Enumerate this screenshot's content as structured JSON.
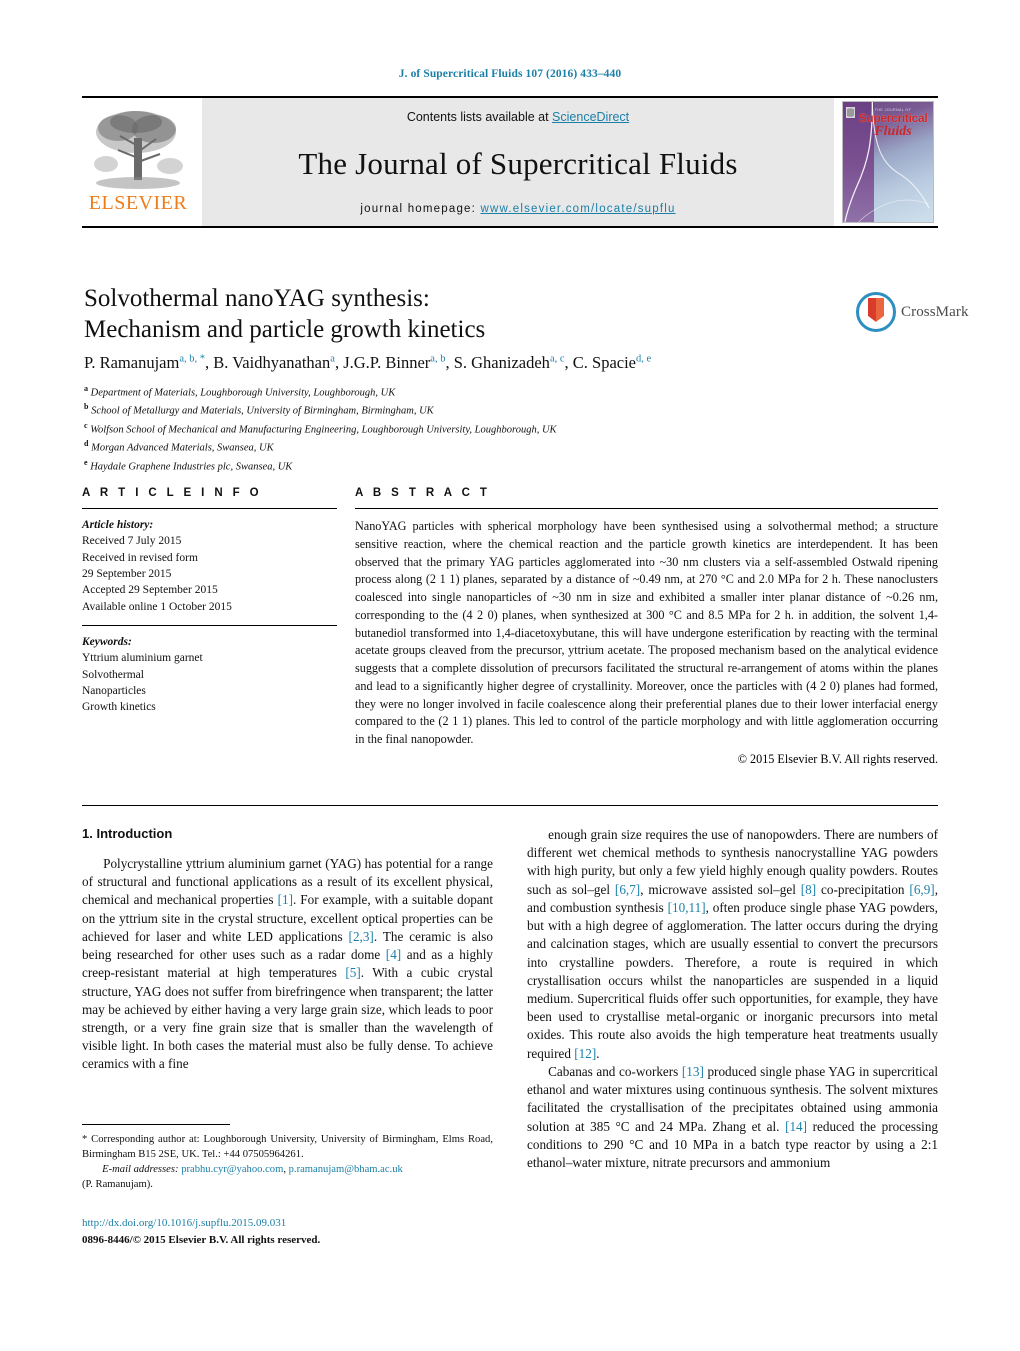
{
  "running_head": "J. of Supercritical Fluids 107 (2016) 433–440",
  "masthead": {
    "contents_prefix": "Contents lists available at ",
    "sciencedirect": "ScienceDirect",
    "journal_title": "The Journal of Supercritical Fluids",
    "homepage_label": "journal homepage:",
    "homepage_url": "www.elsevier.com/locate/supflu",
    "publisher": "ELSEVIER",
    "cover": {
      "kicker": "THE JOURNAL OF",
      "line1": "Supercritical",
      "line2": "Fluids"
    }
  },
  "article": {
    "title_line1": "Solvothermal nanoYAG synthesis:",
    "title_line2": "Mechanism and particle growth kinetics",
    "crossmark_label": "CrossMark",
    "authors": [
      {
        "name": "P. Ramanujam",
        "marks": "a, b, *"
      },
      {
        "name": "B. Vaidhyanathan",
        "marks": "a"
      },
      {
        "name": "J.G.P. Binner",
        "marks": "a, b"
      },
      {
        "name": "S. Ghanizadeh",
        "marks": "a, c"
      },
      {
        "name": "C. Spacie",
        "marks": "d, e"
      }
    ],
    "affiliations": [
      {
        "label": "a",
        "text": "Department of Materials, Loughborough University, Loughborough, UK"
      },
      {
        "label": "b",
        "text": "School of Metallurgy and Materials, University of Birmingham, Birmingham, UK"
      },
      {
        "label": "c",
        "text": "Wolfson School of Mechanical and Manufacturing Engineering, Loughborough University, Loughborough, UK"
      },
      {
        "label": "d",
        "text": "Morgan Advanced Materials, Swansea, UK"
      },
      {
        "label": "e",
        "text": "Haydale Graphene Industries plc, Swansea, UK"
      }
    ]
  },
  "article_info": {
    "heading": "A R T I C L E   I N F O",
    "history_label": "Article history:",
    "history": [
      "Received 7 July 2015",
      "Received in revised form",
      "29 September 2015",
      "Accepted 29 September 2015",
      "Available online 1 October 2015"
    ],
    "keywords_label": "Keywords:",
    "keywords": [
      "Yttrium aluminium garnet",
      "Solvothermal",
      "Nanoparticles",
      "Growth kinetics"
    ]
  },
  "abstract": {
    "heading": "A B S T R A C T",
    "text": "NanoYAG particles with spherical morphology have been synthesised using a solvothermal method; a structure sensitive reaction, where the chemical reaction and the particle growth kinetics are interdependent. It has been observed that the primary YAG particles agglomerated into ~30 nm clusters via a self-assembled Ostwald ripening process along (2 1 1) planes, separated by a distance of ~0.49 nm, at 270 °C and 2.0 MPa for 2 h. These nanoclusters coalesced into single nanoparticles of ~30 nm in size and exhibited a smaller inter planar distance of ~0.26 nm, corresponding to the (4 2 0) planes, when synthesized at 300 °C and 8.5 MPa for 2 h. in addition, the solvent 1,4-butanediol transformed into 1,4-diacetoxybutane, this will have undergone esterification by reacting with the terminal acetate groups cleaved from the precursor, yttrium acetate. The proposed mechanism based on the analytical evidence suggests that a complete dissolution of precursors facilitated the structural re-arrangement of atoms within the planes and lead to a significantly higher degree of crystallinity. Moreover, once the particles with (4 2 0) planes had formed, they were no longer involved in facile coalescence along their preferential planes due to their lower interfacial energy compared to the (2 1 1) planes. This led to control of the particle morphology and with little agglomeration occurring in the final nanopowder.",
    "copyright": "© 2015 Elsevier B.V. All rights reserved."
  },
  "body": {
    "section_number_title": "1.  Introduction",
    "left_paragraph_1": "Polycrystalline yttrium aluminium garnet (YAG) has potential for a range of structural and functional applications as a result of its excellent physical, chemical and mechanical properties [1]. For example, with a suitable dopant on the yttrium site in the crystal structure, excellent optical properties can be achieved for laser and white LED applications [2,3]. The ceramic is also being researched for other uses such as a radar dome [4] and as a highly creep-resistant material at high temperatures [5]. With a cubic crystal structure, YAG does not suffer from birefringence when transparent; the latter may be achieved by either having a very large grain size, which leads to poor strength, or a very fine grain size that is smaller than the wavelength of visible light. In both cases the material must also be fully dense. To achieve ceramics with a fine",
    "right_paragraph_1": "enough grain size requires the use of nanopowders. There are numbers of different wet chemical methods to synthesis nanocrystalline YAG powders with high purity, but only a few yield highly enough quality powders. Routes such as sol–gel [6,7], microwave assisted sol–gel [8] co-precipitation [6,9], and combustion synthesis [10,11], often produce single phase YAG powders, but with a high degree of agglomeration. The latter occurs during the drying and calcination stages, which are usually essential to convert the precursors into crystalline powders. Therefore, a route is required in which crystallisation occurs whilst the nanoparticles are suspended in a liquid medium. Supercritical fluids offer such opportunities, for example, they have been used to crystallise metal-organic or inorganic precursors into metal oxides. This route also avoids the high temperature heat treatments usually required [12].",
    "right_paragraph_2": "Cabanas and co-workers [13] produced single phase YAG in supercritical ethanol and water mixtures using continuous synthesis. The solvent mixtures facilitated the crystallisation of the precipitates obtained using ammonia solution at 385 °C and 24 MPa. Zhang et al. [14] reduced the processing conditions to 290 °C and 10 MPa in a batch type reactor by using a 2:1 ethanol–water mixture, nitrate precursors and ammonium"
  },
  "footnote": {
    "corresponding": "* Corresponding author at: Loughborough University, University of Birmingham, Elms Road, Birmingham B15 2SE, UK. Tel.: +44 07505964261.",
    "email_label": "E-mail addresses:",
    "email1": "prabhu.cyr@yahoo.com",
    "email_sep": ", ",
    "email2": "p.ramanujam@bham.ac.uk",
    "email_owner": "(P. Ramanujam)."
  },
  "footer": {
    "doi": "http://dx.doi.org/10.1016/j.supflu.2015.09.031",
    "issn_line": "0896-8446/© 2015 Elsevier B.V. All rights reserved."
  },
  "colors": {
    "link_blue": "#1b7fa8",
    "elsevier_orange": "#ef7c19",
    "crossmark_red": "#d93c2b",
    "band_grey": "#e8e8e8"
  }
}
